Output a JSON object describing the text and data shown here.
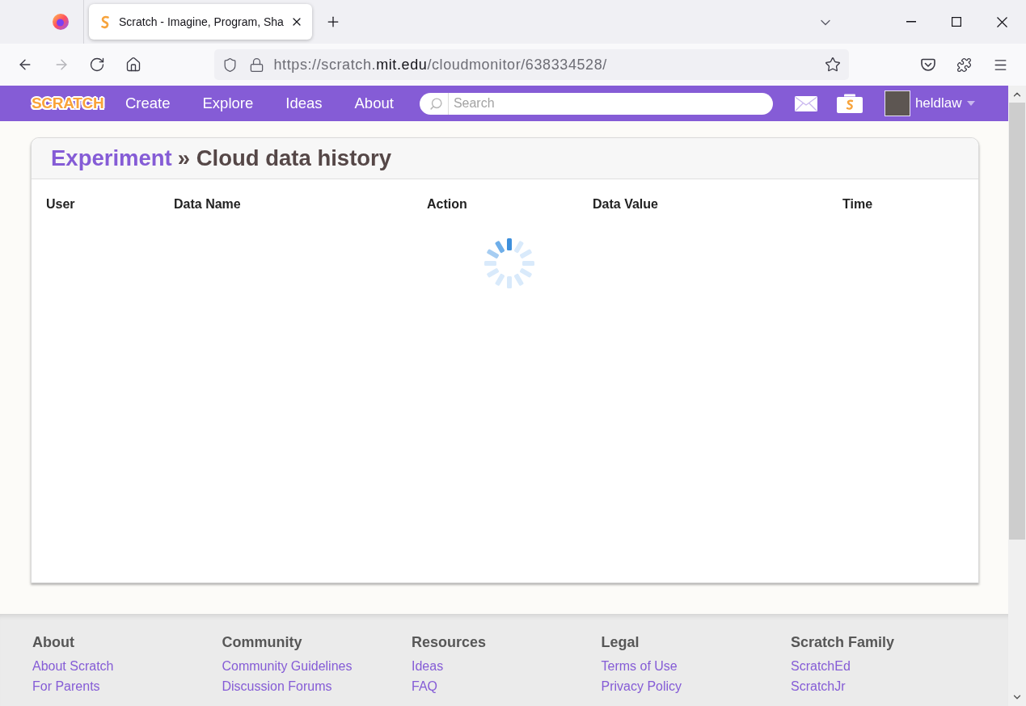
{
  "browser": {
    "tabs": [
      {
        "title": "Scratch - Imagine, Program, Sha",
        "selected": true
      }
    ],
    "toolbar": [
      {
        "kind": "back",
        "disabled": false
      },
      {
        "kind": "forward",
        "disabled": true
      },
      {
        "kind": "reload",
        "disabled": false
      },
      {
        "kind": "home",
        "disabled": false
      }
    ],
    "address": [
      {
        "text": "https://scratch.",
        "kind": "dim"
      },
      {
        "text": "mit.edu",
        "kind": "domain"
      },
      {
        "text": "/cloudmonitor/638334528/",
        "kind": "dim"
      }
    ]
  },
  "site_nav": {
    "logo": "SCRATCH",
    "links": [
      "Create",
      "Explore",
      "Ideas",
      "About"
    ],
    "search": {
      "placeholder": "Search"
    },
    "user": {
      "name": "heldlaw"
    }
  },
  "card": {
    "project": "Experiment",
    "title": "» Cloud data history",
    "columns": [
      "User",
      "Data Name",
      "Action",
      "Data Value",
      "Time"
    ],
    "loading": true
  },
  "footer": {
    "columns": [
      {
        "heading": "About",
        "links": [
          "About Scratch",
          "For Parents"
        ]
      },
      {
        "heading": "Community",
        "links": [
          "Community Guidelines",
          "Discussion Forums"
        ]
      },
      {
        "heading": "Resources",
        "links": [
          "Ideas",
          "FAQ"
        ]
      },
      {
        "heading": "Legal",
        "links": [
          "Terms of Use",
          "Privacy Policy"
        ]
      },
      {
        "heading": "Scratch Family",
        "links": [
          "ScratchEd",
          "ScratchJr"
        ]
      }
    ]
  }
}
